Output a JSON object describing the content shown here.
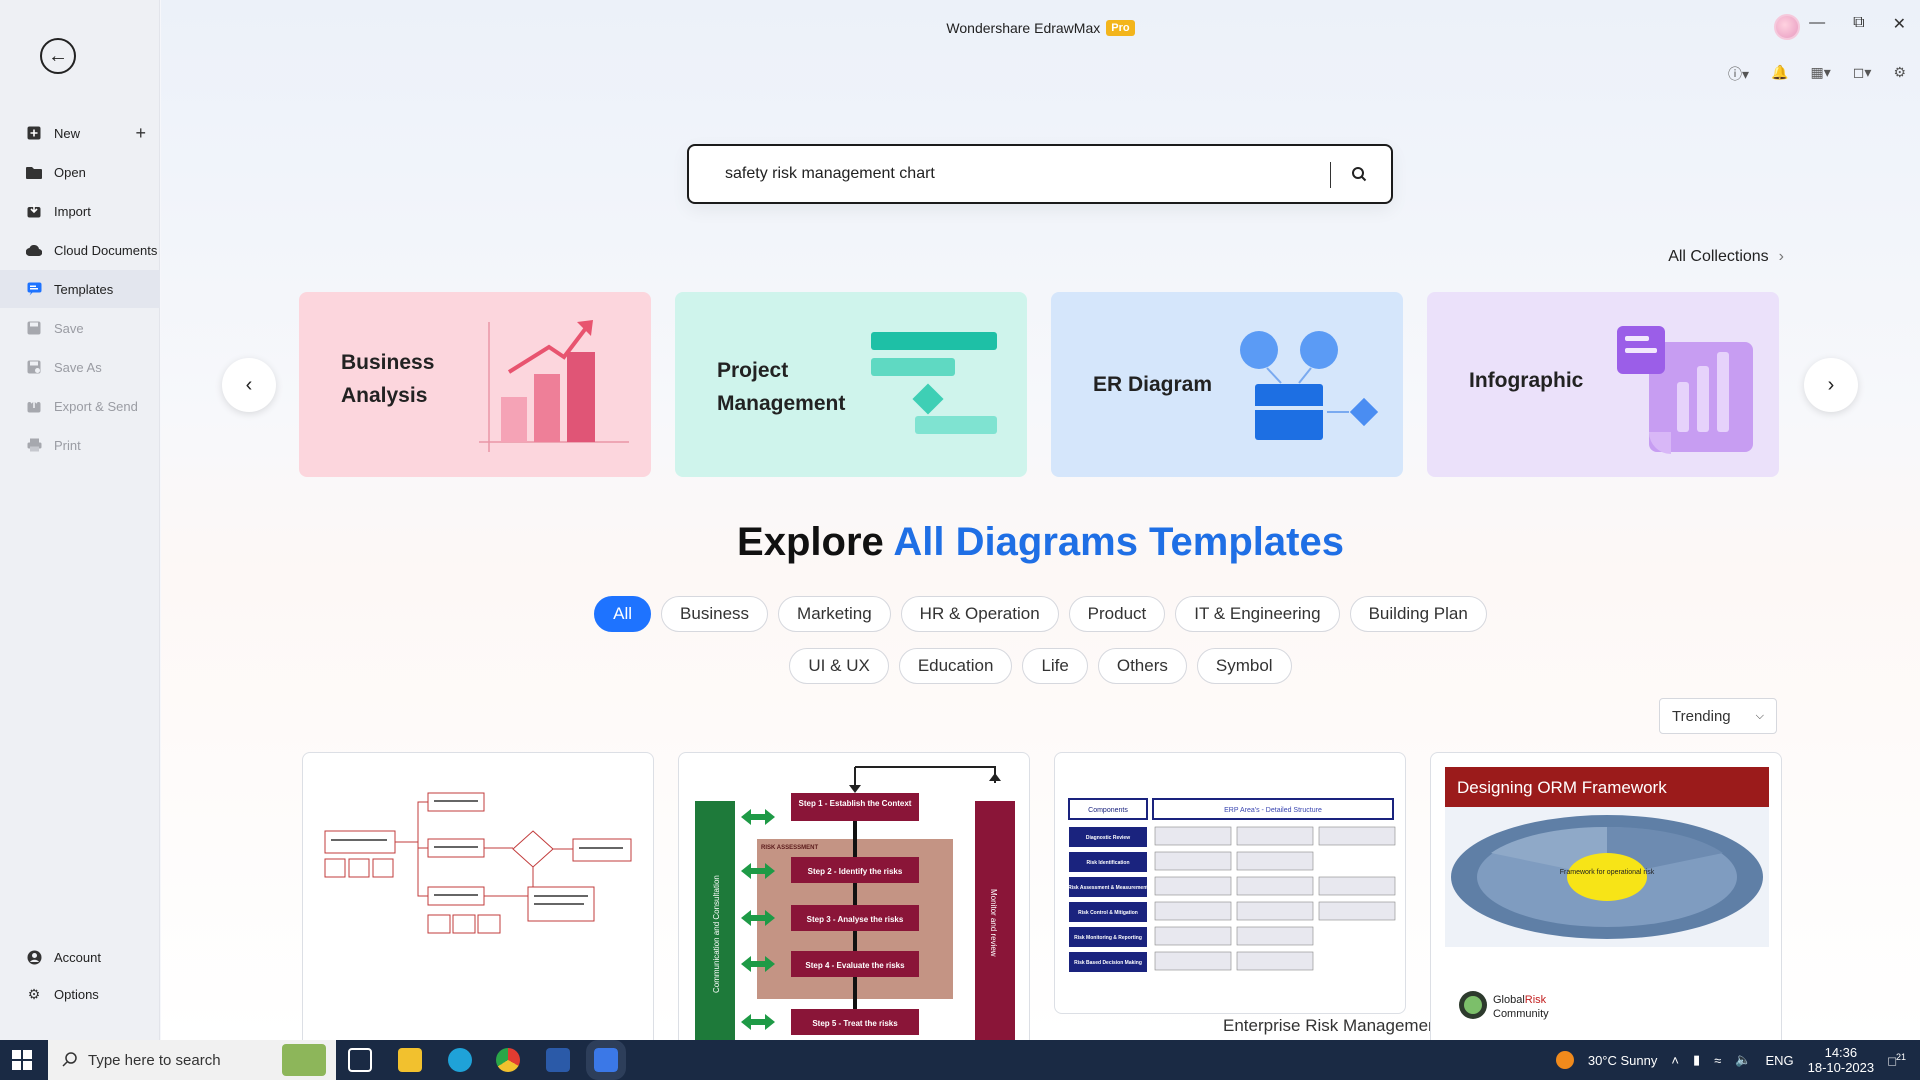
{
  "app": {
    "title": "Wondershare EdrawMax",
    "badge": "Pro"
  },
  "sidebar": {
    "items": [
      {
        "label": "New",
        "icon": "new-file-icon"
      },
      {
        "label": "Open",
        "icon": "folder-icon"
      },
      {
        "label": "Import",
        "icon": "import-icon"
      },
      {
        "label": "Cloud Documents",
        "icon": "cloud-icon"
      },
      {
        "label": "Templates",
        "icon": "templates-icon"
      },
      {
        "label": "Save",
        "icon": "save-icon"
      },
      {
        "label": "Save As",
        "icon": "save-as-icon"
      },
      {
        "label": "Export & Send",
        "icon": "export-icon"
      },
      {
        "label": "Print",
        "icon": "print-icon"
      }
    ],
    "bottom": [
      {
        "label": "Account",
        "icon": "account-icon"
      },
      {
        "label": "Options",
        "icon": "gear-icon"
      }
    ]
  },
  "search": {
    "value": "safety risk management chart"
  },
  "collections": {
    "label": "All Collections"
  },
  "carousel": {
    "cards": [
      {
        "title_line1": "Business",
        "title_line2": "Analysis",
        "color": "#fcd6dd"
      },
      {
        "title_line1": "Project",
        "title_line2": "Management",
        "color": "#cff4ec"
      },
      {
        "title_line1": "ER Diagram",
        "title_line2": "",
        "color": "#d5e6fb"
      },
      {
        "title_line1": "Infographic",
        "title_line2": "",
        "color": "#ebe1fa"
      }
    ]
  },
  "explore": {
    "title_black": "Explore",
    "title_blue": "All Diagrams Templates"
  },
  "categories": {
    "row1": [
      "All",
      "Business",
      "Marketing",
      "HR & Operation",
      "Product",
      "IT & Engineering",
      "Building Plan"
    ],
    "row2": [
      "UI & UX",
      "Education",
      "Life",
      "Others",
      "Symbol"
    ],
    "active": "All"
  },
  "sort": {
    "selected": "Trending"
  },
  "templates": {
    "caption3": "Enterprise Risk Management Framework",
    "t2_steps": [
      "Step 1 - Establish the Context",
      "Step 2 - Identify the risks",
      "Step 3 - Analyse the risks",
      "Step 4 - Evaluate the risks",
      "Step 5 - Treat the risks"
    ],
    "t2_side_left": "Communication and Consultation",
    "t2_side_right": "Monitor and review",
    "t2_assess": "RISK ASSESSMENT",
    "t3_header_left": "Components",
    "t3_header_right": "ERP Area's - Detailed Structure",
    "t3_rows": [
      "Diagnostic Review",
      "Risk Identification",
      "Risk Assessment & Measurement",
      "Risk Control & Mitigation",
      "Risk Monitoring & Reporting",
      "Risk Based Decision Making"
    ],
    "t4_title": "Designing ORM Framework",
    "t4_center": "Framework for operational risk",
    "t4_brand1": "Global",
    "t4_brand2": "Risk",
    "t4_brand3": "Community"
  },
  "taskbar": {
    "search_placeholder": "Type here to search",
    "weather": "30°C  Sunny",
    "lang": "ENG",
    "time": "14:36",
    "date": "18-10-2023",
    "notif_count": "21"
  }
}
